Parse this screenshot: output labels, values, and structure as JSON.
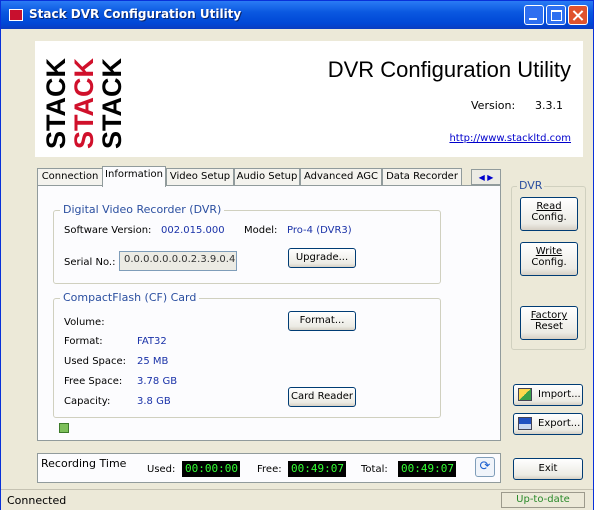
{
  "window": {
    "title": "Stack DVR Configuration Utility"
  },
  "header": {
    "app_title": "DVR Configuration Utility",
    "version_label": "Version:",
    "version_value": "3.3.1",
    "url": "http://www.stackltd.com",
    "logo_word": "STACK"
  },
  "tabs": [
    {
      "label": "Connection",
      "active": false
    },
    {
      "label": "Information",
      "active": true
    },
    {
      "label": "Video Setup",
      "active": false
    },
    {
      "label": "Audio Setup",
      "active": false
    },
    {
      "label": "Advanced AGC",
      "active": false
    },
    {
      "label": "Data Recorder",
      "active": false
    }
  ],
  "dvr_section": {
    "title": "Digital Video Recorder (DVR)",
    "software_label": "Software Version:",
    "software_value": "002.015.000",
    "model_label": "Model:",
    "model_value": "Pro-4 (DVR3)",
    "serial_label": "Serial No.:",
    "serial_value": "0.0.0.0.0.0.0.2.3.9.0.4",
    "upgrade_button": "Upgrade..."
  },
  "cf_section": {
    "title": "CompactFlash (CF) Card",
    "volume_label": "Volume:",
    "format_label": "Format:",
    "format_value": "FAT32",
    "used_label": "Used Space:",
    "used_value": "25 MB",
    "free_label": "Free Space:",
    "free_value": "3.78 GB",
    "capacity_label": "Capacity:",
    "capacity_value": "3.8 GB",
    "format_button": "Format...",
    "card_reader_button": "Card Reader"
  },
  "dvr_panel": {
    "title": "DVR",
    "read_config": [
      "Read",
      "Config."
    ],
    "write_config": [
      "Write",
      "Config."
    ],
    "factory_reset": [
      "Factory",
      "Reset"
    ]
  },
  "side_buttons": {
    "import": "Import...",
    "export": "Export...",
    "exit": "Exit"
  },
  "recording": {
    "title": "Recording Time",
    "used_label": "Used:",
    "used_value": "00:00:00",
    "free_label": "Free:",
    "free_value": "00:49:07",
    "total_label": "Total:",
    "total_value": "00:49:07"
  },
  "status": {
    "left": "Connected",
    "right": "Up-to-date"
  },
  "colors": {
    "accent": "#0054e3",
    "lcd_text": "#32ff32",
    "value_text": "#1a32a8"
  }
}
